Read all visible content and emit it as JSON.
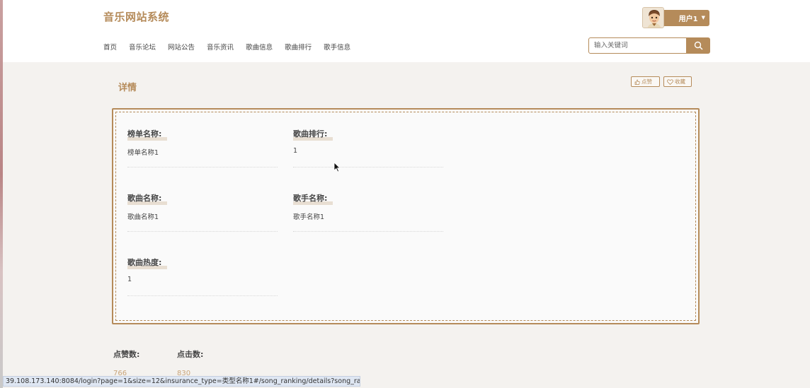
{
  "header": {
    "site_title": "音乐网站系统",
    "nav": [
      "首页",
      "音乐论坛",
      "网站公告",
      "音乐资讯",
      "歌曲信息",
      "歌曲排行",
      "歌手信息"
    ],
    "user_label": "用户1",
    "search_placeholder": "输入关键词"
  },
  "main": {
    "heading": "详情",
    "like_button": "点赞",
    "collect_button": "收藏",
    "fields": [
      {
        "label": "榜单名称:",
        "value": "榜单名称1"
      },
      {
        "label": "歌曲排行:",
        "value": "1"
      },
      {
        "label": "歌曲名称:",
        "value": "歌曲名称1"
      },
      {
        "label": "歌手名称:",
        "value": "歌手名称1"
      },
      {
        "label": "歌曲热度:",
        "value": "1"
      }
    ],
    "stats": [
      {
        "label": "点赞数:",
        "value": "766"
      },
      {
        "label": "点击数:",
        "value": "830"
      }
    ]
  },
  "status_url": "39.108.173.140:8084/login?page=1&size=12&insurance_type=类型名称1#/song_ranking/details?song_ranking_id=1",
  "colors": {
    "accent": "#b58b5a",
    "background": "#f4f2ef"
  }
}
